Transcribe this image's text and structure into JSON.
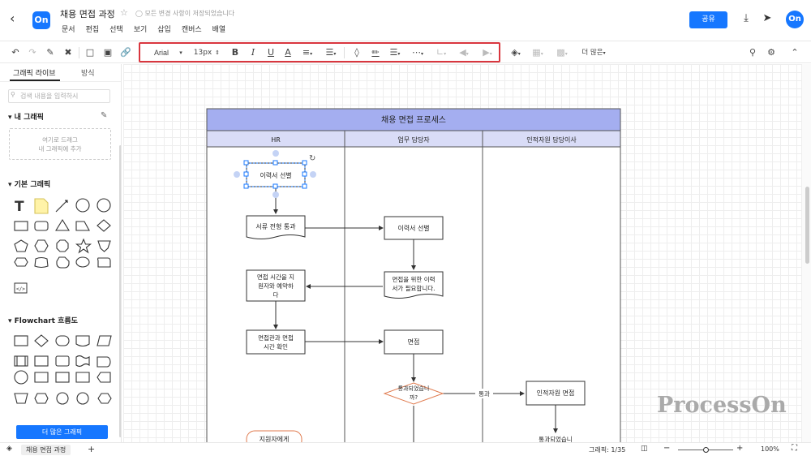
{
  "app": {
    "title": "채용 면접 과정",
    "saved_status": "모든 변경 사항이 저장되었습니다",
    "logo": "On",
    "menu": [
      "문서",
      "편집",
      "선택",
      "보기",
      "삽입",
      "캔버스",
      "배열"
    ],
    "share_label": "공유",
    "avatar": "On"
  },
  "toolbar": {
    "font_family": "Arial",
    "font_size": "13px",
    "bold": "B",
    "italic": "I",
    "underline": "U",
    "font_color": "A",
    "more_label": "더 많은"
  },
  "sidebar": {
    "tab_library": "그래픽 라이브",
    "tab_style": "방식",
    "search_placeholder": "검색 내용을 입력하시",
    "my_graphics": "내 그래픽",
    "drop_hint_1": "여기로 드래그",
    "drop_hint_2": "내 그래픽에 추가",
    "basic": "기본 그래픽",
    "flowchart": "Flowchart 흐름도",
    "more_button": "더 많은 그래픽"
  },
  "diagram": {
    "pool_title": "채용 면접 프로세스",
    "lanes": [
      "HR",
      "업무 담당자",
      "인적자원 담당이사"
    ],
    "nodes": {
      "n1": "이력서 선별",
      "n2": "서류 전형 통과",
      "n3": "이력서 선별",
      "n4a": "면접을 위한 이력",
      "n4b": "서가 필요합니다.",
      "n5a": "면접 시간을 지",
      "n5b": "원자와 예약하",
      "n5c": "다",
      "n6a": "면접관과 면접",
      "n6b": "시간 확인",
      "n7": "면접",
      "n8a": "통과되었습니",
      "n8b": "까?",
      "n9": "인적자원 면접",
      "n10": "지원자에게",
      "n11": "통과되었습니"
    },
    "edge_label": "통과"
  },
  "status": {
    "page_tab": "채용 면접 과정",
    "shape_count": "그래픽: 1/35",
    "zoom": "100%"
  },
  "watermark": "ProcessOn",
  "colors": {
    "accent": "#1677ff",
    "pool_header": "#a4aef0",
    "lane_header": "#d9dcf7",
    "decision": "#e07b4f",
    "highlight": "#d9363e"
  }
}
